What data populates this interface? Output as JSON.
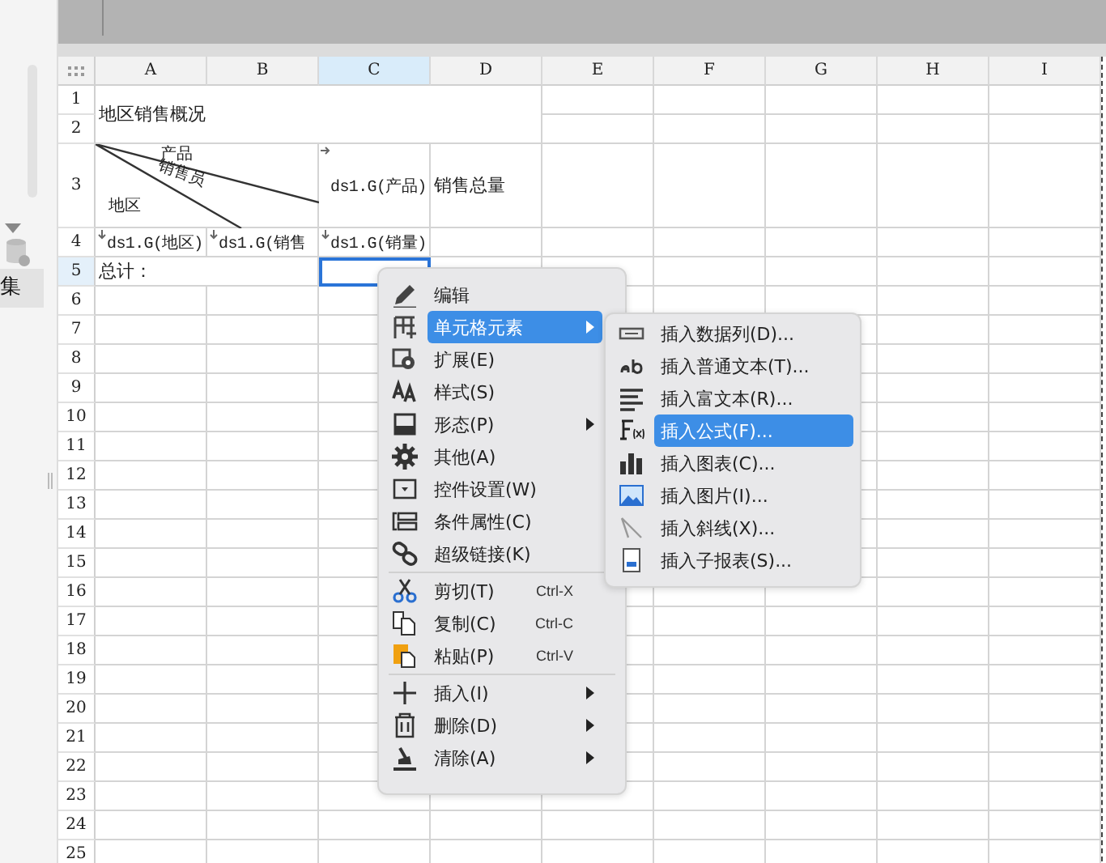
{
  "sidebar": {
    "label": "集"
  },
  "sheet": {
    "columns": [
      {
        "label": "A",
        "selected": false
      },
      {
        "label": "B",
        "selected": false
      },
      {
        "label": "C",
        "selected": true
      },
      {
        "label": "D",
        "selected": false
      },
      {
        "label": "E",
        "selected": false
      },
      {
        "label": "F",
        "selected": false
      },
      {
        "label": "G",
        "selected": false
      },
      {
        "label": "H",
        "selected": false
      },
      {
        "label": "I",
        "selected": false
      }
    ],
    "rows": [
      {
        "label": "1",
        "selected": false
      },
      {
        "label": "2",
        "selected": false
      },
      {
        "label": "3",
        "selected": false
      },
      {
        "label": "4",
        "selected": false
      },
      {
        "label": "5",
        "selected": true
      },
      {
        "label": "6",
        "selected": false
      },
      {
        "label": "7",
        "selected": false
      },
      {
        "label": "8",
        "selected": false
      },
      {
        "label": "9",
        "selected": false
      },
      {
        "label": "10",
        "selected": false
      },
      {
        "label": "11",
        "selected": false
      },
      {
        "label": "12",
        "selected": false
      },
      {
        "label": "13",
        "selected": false
      },
      {
        "label": "14",
        "selected": false
      },
      {
        "label": "15",
        "selected": false
      },
      {
        "label": "16",
        "selected": false
      },
      {
        "label": "17",
        "selected": false
      },
      {
        "label": "18",
        "selected": false
      },
      {
        "label": "19",
        "selected": false
      },
      {
        "label": "20",
        "selected": false
      },
      {
        "label": "21",
        "selected": false
      },
      {
        "label": "22",
        "selected": false
      },
      {
        "label": "23",
        "selected": false
      },
      {
        "label": "24",
        "selected": false
      },
      {
        "label": "25",
        "selected": false
      }
    ],
    "cells": [
      {
        "kind": "text",
        "text": "地区销售概况",
        "selected": false
      },
      {
        "kind": "slash",
        "labels": [
          "产品",
          "销售员",
          "地区"
        ],
        "selected": false
      },
      {
        "kind": "expand_right",
        "text": "ds1.G(产品)",
        "selected": false
      },
      {
        "kind": "text",
        "text": "销售总量",
        "selected": false
      },
      {
        "kind": "expand_down",
        "text": "ds1.G(地区)",
        "selected": false
      },
      {
        "kind": "expand_down",
        "text": "ds1.G(销售",
        "selected": false
      },
      {
        "kind": "expand_down",
        "text": "ds1.G(销量)",
        "selected": false
      },
      {
        "kind": "text",
        "text": "总计：",
        "selected": false
      },
      {
        "kind": "empty",
        "selected": true
      }
    ]
  },
  "context_menu": {
    "items": [
      {
        "kind": "item",
        "label": "编辑",
        "submenu": false,
        "selected": false
      },
      {
        "kind": "item",
        "label": "单元格元素",
        "submenu": true,
        "selected": true
      },
      {
        "kind": "item",
        "label": "扩展(E)",
        "submenu": false,
        "selected": false
      },
      {
        "kind": "item",
        "label": "样式(S)",
        "submenu": false,
        "selected": false
      },
      {
        "kind": "item",
        "label": "形态(P)",
        "submenu": true,
        "selected": false
      },
      {
        "kind": "item",
        "label": "其他(A)",
        "submenu": false,
        "selected": false
      },
      {
        "kind": "item",
        "label": "控件设置(W)",
        "submenu": false,
        "selected": false
      },
      {
        "kind": "item",
        "label": "条件属性(C)",
        "submenu": false,
        "selected": false
      },
      {
        "kind": "item",
        "label": "超级链接(K)",
        "submenu": false,
        "selected": false
      },
      {
        "kind": "separator"
      },
      {
        "kind": "item",
        "label": "剪切(T)",
        "shortcut": "Ctrl-X",
        "submenu": false,
        "selected": false
      },
      {
        "kind": "item",
        "label": "复制(C)",
        "shortcut": "Ctrl-C",
        "submenu": false,
        "selected": false
      },
      {
        "kind": "item",
        "label": "粘贴(P)",
        "shortcut": "Ctrl-V",
        "submenu": false,
        "selected": false
      },
      {
        "kind": "separator"
      },
      {
        "kind": "item",
        "label": "插入(I)",
        "submenu": true,
        "selected": false
      },
      {
        "kind": "item",
        "label": "删除(D)",
        "submenu": true,
        "selected": false
      },
      {
        "kind": "item",
        "label": "清除(A)",
        "submenu": true,
        "selected": false
      }
    ]
  },
  "submenu": {
    "items": [
      {
        "label": "插入数据列(D)...",
        "selected": false
      },
      {
        "label": "插入普通文本(T)...",
        "selected": false
      },
      {
        "label": "插入富文本(R)...",
        "selected": false
      },
      {
        "label": "插入公式(F)...",
        "selected": true
      },
      {
        "label": "插入图表(C)...",
        "selected": false
      },
      {
        "label": "插入图片(I)...",
        "selected": false
      },
      {
        "label": "插入斜线(X)...",
        "selected": false
      },
      {
        "label": "插入子报表(S)...",
        "selected": false
      }
    ]
  }
}
